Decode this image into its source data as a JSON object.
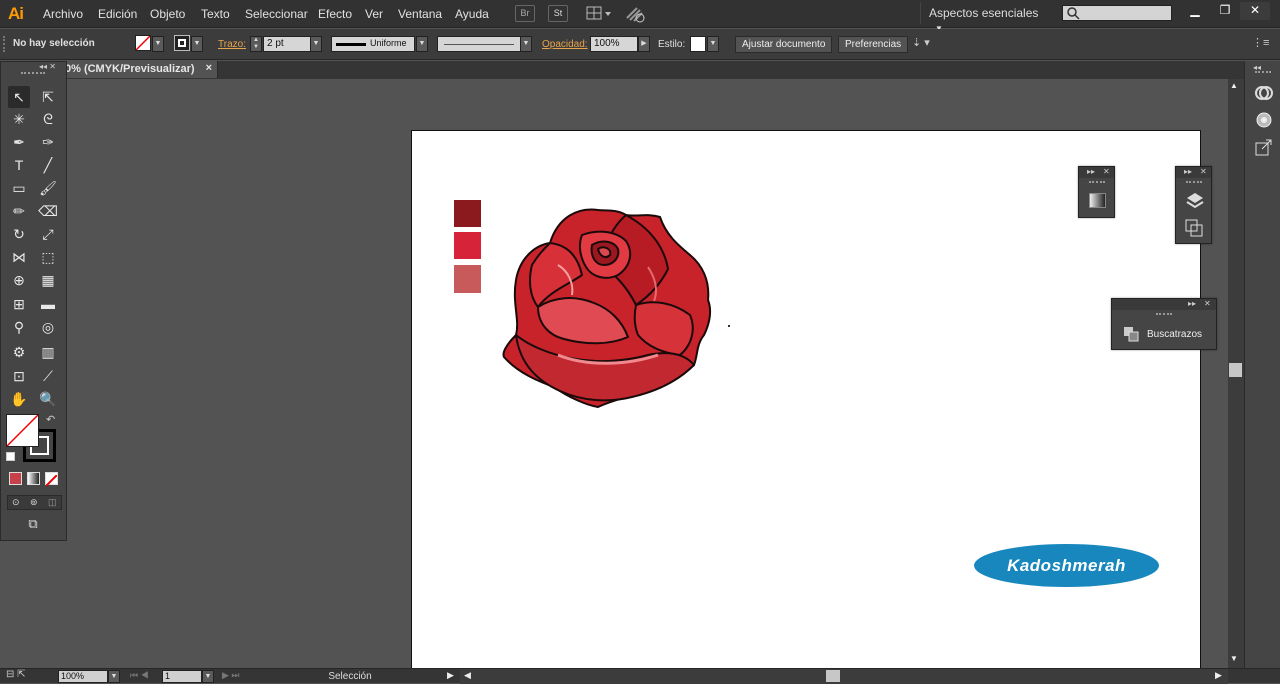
{
  "app": {
    "logo": "Ai"
  },
  "menu": [
    "Archivo",
    "Edición",
    "Objeto",
    "Texto",
    "Seleccionar",
    "Efecto",
    "Ver",
    "Ventana",
    "Ayuda"
  ],
  "menubar_buttons": [
    "Br",
    "St"
  ],
  "workspace": {
    "label": "Aspectos esenciales"
  },
  "window_controls": [
    "minimize-icon",
    "restore-icon",
    "close-icon"
  ],
  "control_bar": {
    "selection": "No hay selección",
    "trazo_label": "Trazo:",
    "trazo_value": "2 pt",
    "stroke_profile": "Uniforme",
    "opacity_label": "Opacidad:",
    "opacity_value": "100%",
    "style_label": "Estilo:",
    "fit_document": "Ajustar documento",
    "preferences": "Preferencias"
  },
  "document_tab": {
    "title": "0% (CMYK/Previsualizar)",
    "close": "×"
  },
  "panels": {
    "buscatrazos": {
      "title": "Buscatrazos"
    }
  },
  "swatches": [
    "#8b1a1e",
    "#d7233a",
    "#c95a5c"
  ],
  "logo": {
    "text": "Kadoshmerah",
    "color": "#1787bd"
  },
  "status_bar": {
    "zoom": "100%",
    "page": "1",
    "tool": "Selección"
  },
  "colors": {
    "accent": "#ff9a00",
    "rose": "#d0232a"
  }
}
